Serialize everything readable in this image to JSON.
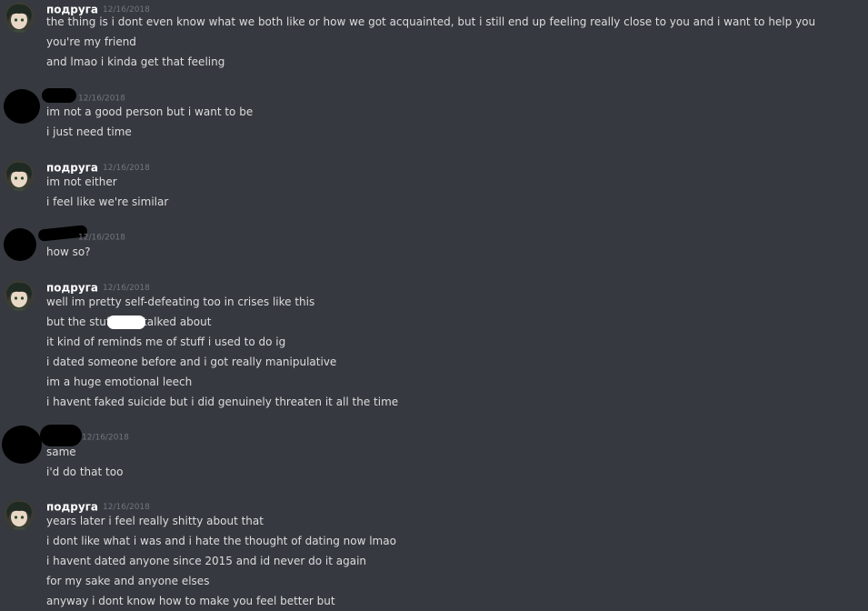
{
  "groups": [
    {
      "author": "подруга",
      "timestamp": "12/16/2018",
      "redacted_author": false,
      "messages": [
        "the thing is i dont even know what we both like or how we got acquainted, but i still end up feeling really close to you and i want to help you",
        "you're my friend",
        "and lmao i kinda get that feeling"
      ]
    },
    {
      "author": "",
      "timestamp": "12/16/2018",
      "redacted_author": true,
      "messages": [
        "im not a good person but i want to be",
        "i just need time"
      ]
    },
    {
      "author": "подруга",
      "timestamp": "12/16/2018",
      "redacted_author": false,
      "messages": [
        "im not either",
        "i feel like we're similar"
      ]
    },
    {
      "author": "",
      "timestamp": "12/16/2018",
      "redacted_author": true,
      "messages": [
        "how so?"
      ]
    },
    {
      "author": "подруга",
      "timestamp": "12/16/2018",
      "redacted_author": false,
      "messages": [
        "well im pretty self-defeating too in crises like this",
        "but the stuff",
        "it kind of reminds me of stuff i used to do ig",
        "i dated someone before and i got really manipulative",
        "im a huge emotional leech",
        "i havent faked suicide but i did genuinely threaten it all the time"
      ],
      "redacted_tail": "talked about"
    },
    {
      "author": "",
      "timestamp": "12/16/2018",
      "redacted_author": true,
      "messages": [
        "same",
        "i'd do that too"
      ]
    },
    {
      "author": "подруга",
      "timestamp": "12/16/2018",
      "redacted_author": false,
      "messages": [
        "years later i feel really shitty about that",
        "i dont like what i was and i hate the thought of dating now lmao",
        "i havent dated anyone since 2015 and id never do it again",
        "for my sake and anyone elses",
        "anyway i dont know how to make you feel better but"
      ]
    }
  ],
  "colors": {
    "background": "#36393f",
    "username": "#ffffff",
    "text": "#dcddde",
    "timestamp": "#72767d",
    "redaction": "#000000"
  },
  "icons": {
    "friend_avatar": "anime-avatar-icon",
    "redacted_avatar": "redacted-avatar-icon"
  }
}
